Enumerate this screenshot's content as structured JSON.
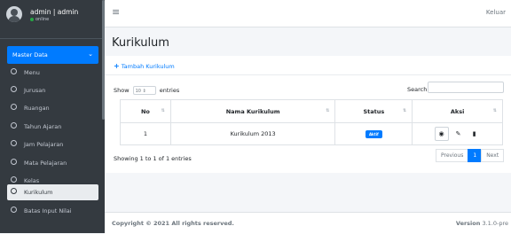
{
  "sidebar": {
    "user": {
      "name": "admin | admin",
      "status": "online"
    },
    "menu_header": "Master Data",
    "items": [
      {
        "label": "Menu"
      },
      {
        "label": "Jurusan"
      },
      {
        "label": "Ruangan"
      },
      {
        "label": "Tahun Ajaran"
      },
      {
        "label": "Jam Pelajaran"
      },
      {
        "label": "Mata Pelajaran"
      },
      {
        "label": "Kelas"
      },
      {
        "label": "Kurikulum"
      },
      {
        "label": "Batas Input Nilai"
      }
    ]
  },
  "topbar": {
    "logout": "Keluar"
  },
  "page": {
    "title": "Kurikulum",
    "add_label": "Tambah Kurikulum"
  },
  "table_controls": {
    "show": "Show",
    "page_size": "10",
    "entries": "entries",
    "search_label": "Search:"
  },
  "table": {
    "headers": [
      "No",
      "Nama Kurikulum",
      "Status",
      "Aksi"
    ],
    "rows": [
      {
        "no": "1",
        "nama": "Kurikulum 2013",
        "status": "Aktif"
      }
    ]
  },
  "info": "Showing 1 to 1 of 1 entries",
  "pagination": {
    "previous": "Previous",
    "current": "1",
    "next": "Next"
  },
  "footer": {
    "copyright": "Copyright © 2021 All rights reserved.",
    "version_label": "Version",
    "version": "3.1.0-pre"
  },
  "colors": {
    "sidebar": "#343a40",
    "accent": "#007bff",
    "background": "#f4f6f9"
  }
}
